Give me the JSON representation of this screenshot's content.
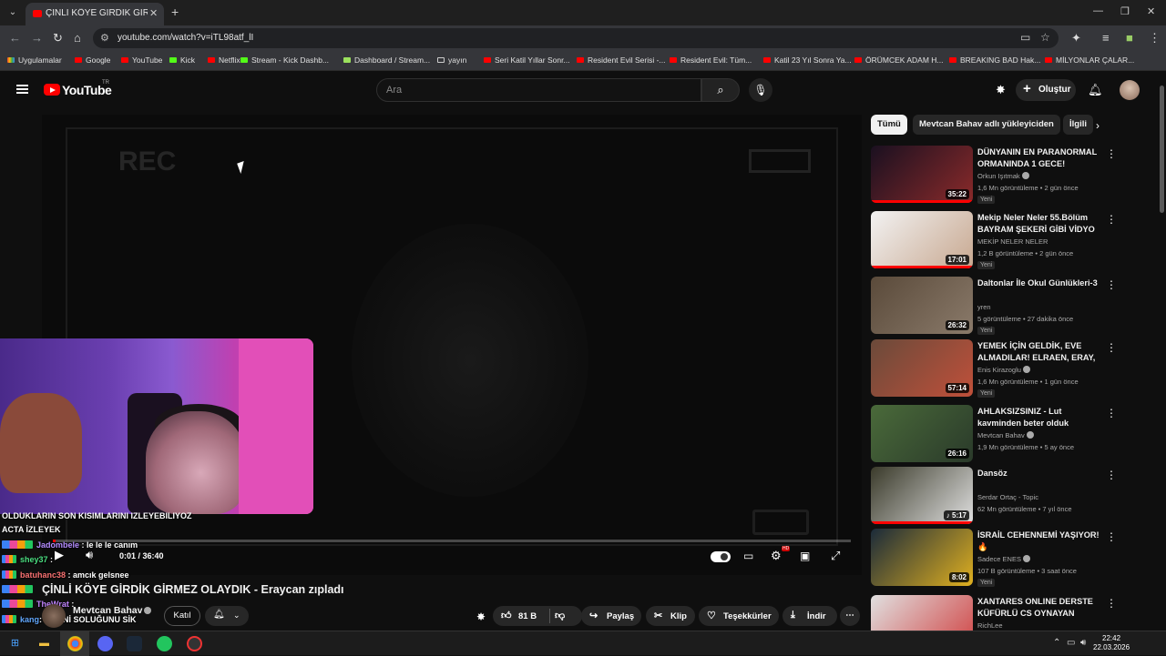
{
  "browser": {
    "tab_title": "ÇİNLİ KÖYE GİRDİK GİRMEZ OL",
    "url": "youtube.com/watch?v=iTL98atf_lI",
    "bookmarks": [
      "Uygulamalar",
      "Google",
      "YouTube",
      "Kick",
      "Netflix",
      "Stream - Kick Dashb...",
      "Dashboard / Stream...",
      "yayın",
      "Seri Katil Yıllar Sonr...",
      "Resident Evil Serisi -...",
      "Resident Evil: Tüm...",
      "Katil 23 Yıl Sonra Ya...",
      "ÖRÜMCEK ADAM H...",
      "BREAKING BAD Hak...",
      "MİLYONLAR ÇALAR..."
    ]
  },
  "header": {
    "logo": "YouTube",
    "logo_suffix": "TR",
    "search_placeholder": "Ara",
    "create_label": "Oluştur"
  },
  "player": {
    "rec_text": "REC",
    "current_time": "0:01 / 36:40",
    "progress": 0.0005,
    "accent": "#ff0000"
  },
  "chat": [
    {
      "user": "",
      "msg": "OLDUKLARIN SON KISIMLARINI IZLEYEBILIYOZ"
    },
    {
      "user": "",
      "msg": "ACTA İZLEYEK"
    },
    {
      "user": "Jadombele",
      "msg": ": le le le canım"
    },
    {
      "user": "shey37",
      "msg": ":"
    },
    {
      "user": "batuhanc38",
      "msg": ": amcık gelsnee"
    },
    {
      "user": "",
      "msg": ""
    },
    {
      "user": "TheWrat",
      "msg": ":"
    },
    {
      "user": "kang",
      "msg": ": SESİNİ SOLUĞUNU SİK"
    }
  ],
  "video": {
    "title": "ÇİNLİ KÖYE GİRDİK GİRMEZ OLAYDIK - Eraycan zıpladı",
    "channel": "Mevtcan Bahav",
    "join_label": "Katıl",
    "like_count": "81 B",
    "share_label": "Paylaş",
    "clip_label": "Klip",
    "thanks_label": "Teşekkürler",
    "download_label": "İndir"
  },
  "chips": [
    "Tümü",
    "Mevtcan Bahav adlı yükleyiciden",
    "İlgili"
  ],
  "recommendations": [
    {
      "title": "DÜNYANIN EN PARANORMAL ORMANINDA 1 GECE!",
      "channel": "Orkun Işıtmak",
      "verified": true,
      "meta": "1,6 Mn görüntüleme • 2 gün önce",
      "badge": "Yeni",
      "duration": "35:22",
      "thumb": [
        "#1a1020",
        "#8a2a2a"
      ],
      "watched": 1.0
    },
    {
      "title": "Mekip Neler Neler 55.Bölüm BAYRAM ŞEKERİ GİBİ VİDYO ...",
      "channel": "MEKİP NELER NELER",
      "verified": false,
      "meta": "1,2 B görüntüleme • 2 gün önce",
      "badge": "Yeni",
      "duration": "17:01",
      "thumb": [
        "#f2f2f2",
        "#c8a890"
      ],
      "watched": 1.0
    },
    {
      "title": "Daltonlar İle Okul Günlükleri-3",
      "channel": "yren",
      "verified": false,
      "meta": "5 görüntüleme • 27 dakika önce",
      "badge": "Yeni",
      "duration": "26:32",
      "thumb": [
        "#5a4a3a",
        "#8a7a6a"
      ],
      "watched": 0
    },
    {
      "title": "YEMEK İÇİN GELDİK, EVE ALMADILAR! ELRAEN, ERAY, ...",
      "channel": "Enis Kirazoglu",
      "verified": true,
      "meta": "1,6 Mn görüntüleme • 1 gün önce",
      "badge": "Yeni",
      "duration": "57:14",
      "thumb": [
        "#6a4a3a",
        "#c0503a"
      ],
      "watched": 0
    },
    {
      "title": "AHLAKSIZSINIZ - Lut kavminden beter olduk",
      "channel": "Mevtcan Bahav",
      "verified": true,
      "meta": "1,9 Mn görüntüleme • 5 ay önce",
      "badge": "",
      "duration": "26:16",
      "thumb": [
        "#4a6a3a",
        "#2a3a2a"
      ],
      "watched": 0
    },
    {
      "title": "Dansöz",
      "channel": "Serdar Ortaç - Topic",
      "verified": false,
      "meta": "62 Mn görüntüleme • 7 yıl önce",
      "badge": "",
      "duration": "♪ 5:17",
      "thumb": [
        "#3a3a2a",
        "#e0e0e0"
      ],
      "watched": 1.0
    },
    {
      "title": "İSRAİL CEHENNEMİ YAŞIYOR! 🔥",
      "channel": "Sadece ENES",
      "verified": true,
      "meta": "107 B görüntüleme • 3 saat önce",
      "badge": "Yeni",
      "duration": "8:02",
      "thumb": [
        "#1a2a3a",
        "#e0b020"
      ],
      "watched": 0
    },
    {
      "title": "XANTARES ONLINE DERSTE KÜFÜRLÜ CS OYNAYAN ÇOCU...",
      "channel": "RichLee",
      "verified": false,
      "meta": "",
      "badge": "",
      "duration": "",
      "thumb": [
        "#e0e0e0",
        "#d04040"
      ],
      "watched": 0
    }
  ],
  "taskbar": {
    "time": "22:42",
    "date": "22.03.2026"
  }
}
